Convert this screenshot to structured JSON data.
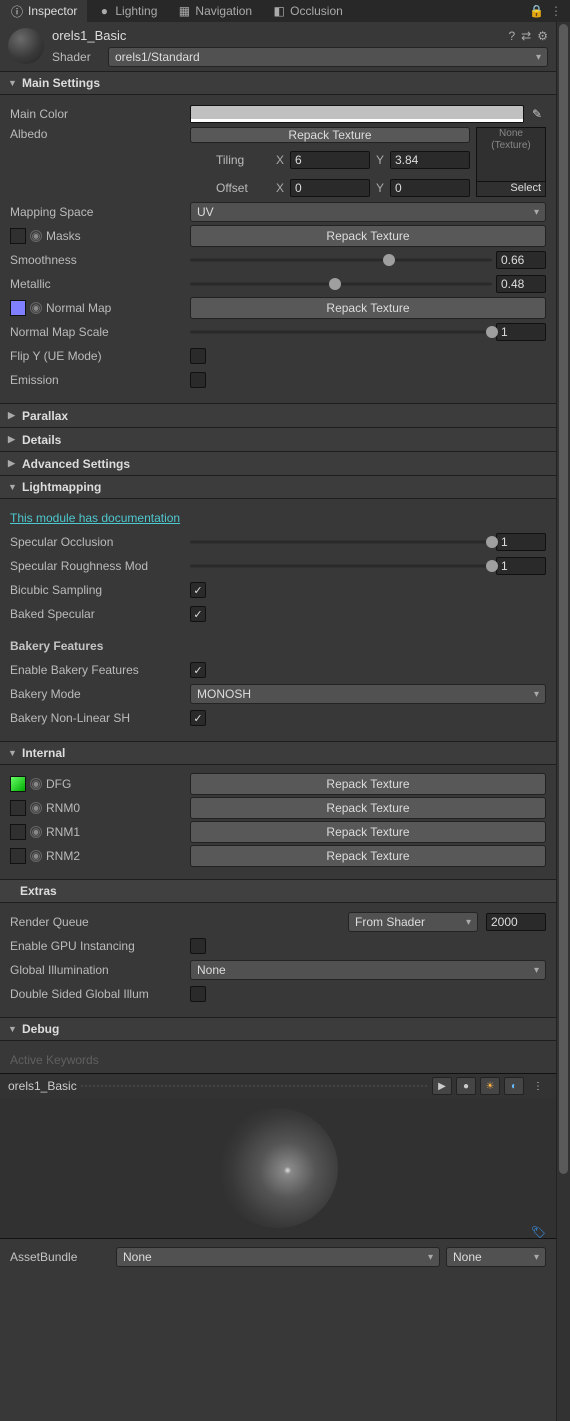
{
  "tabs": {
    "inspector": "Inspector",
    "lighting": "Lighting",
    "navigation": "Navigation",
    "occlusion": "Occlusion"
  },
  "header": {
    "material_name": "orels1_Basic",
    "shader_label": "Shader",
    "shader_value": "orels1/Standard"
  },
  "main": {
    "title": "Main Settings",
    "main_color": "Main Color",
    "albedo": "Albedo",
    "repack": "Repack Texture",
    "tex_none": "None",
    "tex_texture": "(Texture)",
    "tex_select": "Select",
    "tiling": "Tiling",
    "tiling_x": "6",
    "tiling_y": "3.84",
    "offset": "Offset",
    "offset_x": "0",
    "offset_y": "0",
    "mapping_space": "Mapping Space",
    "mapping_space_value": "UV",
    "masks": "Masks",
    "smoothness": "Smoothness",
    "smoothness_val": "0.66",
    "metallic": "Metallic",
    "metallic_val": "0.48",
    "normal_map": "Normal Map",
    "normal_map_scale": "Normal Map Scale",
    "normal_map_scale_val": "1",
    "flip_y": "Flip Y (UE Mode)",
    "emission": "Emission"
  },
  "collapsed": {
    "parallax": "Parallax",
    "details": "Details",
    "advanced": "Advanced Settings"
  },
  "lightmapping": {
    "title": "Lightmapping",
    "doc_link": "This module has documentation",
    "spec_occ": "Specular Occlusion",
    "spec_occ_val": "1",
    "spec_rough": "Specular Roughness Mod",
    "spec_rough_val": "1",
    "bicubic": "Bicubic Sampling",
    "baked_spec": "Baked Specular",
    "bakery_title": "Bakery Features",
    "enable_bakery": "Enable Bakery Features",
    "bakery_mode": "Bakery Mode",
    "bakery_mode_val": "MONOSH",
    "bakery_nlsh": "Bakery Non-Linear SH"
  },
  "internal": {
    "title": "Internal",
    "dfg": "DFG",
    "rnm0": "RNM0",
    "rnm1": "RNM1",
    "rnm2": "RNM2",
    "repack": "Repack Texture"
  },
  "extras": {
    "title": "Extras",
    "render_queue": "Render Queue",
    "render_queue_mode": "From Shader",
    "render_queue_val": "2000",
    "gpu_inst": "Enable GPU Instancing",
    "gi": "Global Illumination",
    "gi_val": "None",
    "double_sided": "Double Sided Global Illum"
  },
  "debug": {
    "title": "Debug",
    "active_kw": "Active Keywords"
  },
  "footer": {
    "name": "orels1_Basic"
  },
  "assetbundle": {
    "label": "AssetBundle",
    "value": "None",
    "variant": "None"
  }
}
